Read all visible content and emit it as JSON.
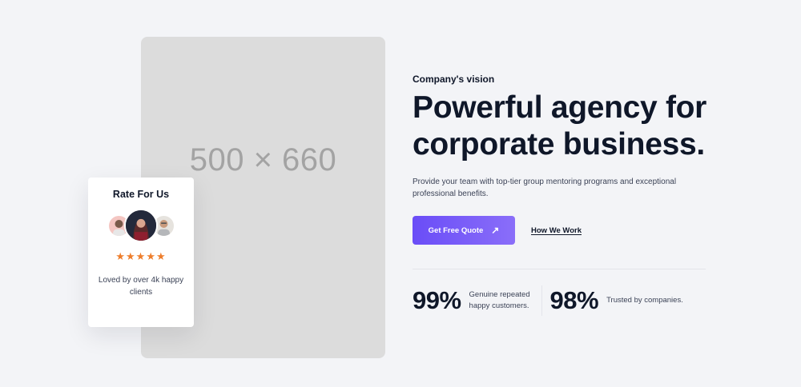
{
  "placeholder": {
    "label": "500 × 660"
  },
  "rate_card": {
    "title": "Rate For Us",
    "stars": "★★★★★",
    "rating": 5,
    "text": "Loved by over 4k happy clients"
  },
  "hero": {
    "eyebrow": "Company's vision",
    "headline_line1": "Powerful agency for",
    "headline_line2": "corporate business.",
    "description": "Provide your team with top-tier group mentoring programs and exceptional professional benefits.",
    "cta_label": "Get Free Quote",
    "cta_icon": "arrow-up-right-icon",
    "link_label": "How We Work"
  },
  "stats": [
    {
      "value": "99%",
      "label": "Genuine repeated happy customers."
    },
    {
      "value": "98%",
      "label": "Trusted by companies."
    }
  ],
  "colors": {
    "background": "#f3f4f7",
    "accent_start": "#6a4df7",
    "accent_end": "#8a6ef9",
    "star": "#ee7d2b",
    "text": "#0f1729"
  }
}
